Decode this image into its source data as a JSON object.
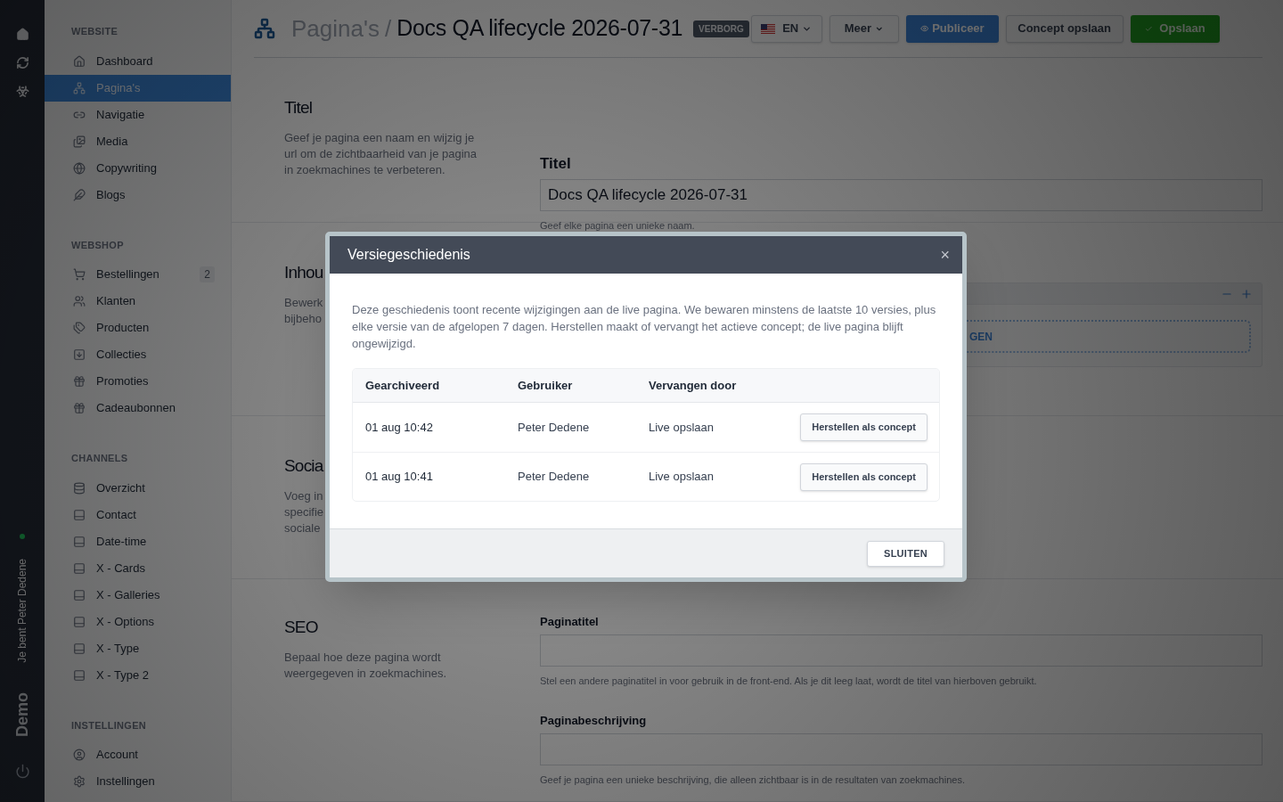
{
  "rail": {
    "online": true,
    "user_label": "Je bent Peter Dedene",
    "brand": "Demo"
  },
  "sidebar": {
    "sections": [
      {
        "title": "WEBSITE",
        "items": [
          {
            "label": "Dashboard",
            "selected": false
          },
          {
            "label": "Pagina's",
            "selected": true
          },
          {
            "label": "Navigatie",
            "selected": false
          },
          {
            "label": "Media",
            "selected": false
          },
          {
            "label": "Copywriting",
            "selected": false
          },
          {
            "label": "Blogs",
            "selected": false
          }
        ]
      },
      {
        "title": "WEBSHOP",
        "items": [
          {
            "label": "Bestellingen",
            "selected": false,
            "badge": "2"
          },
          {
            "label": "Klanten",
            "selected": false
          },
          {
            "label": "Producten",
            "selected": false
          },
          {
            "label": "Collecties",
            "selected": false
          },
          {
            "label": "Promoties",
            "selected": false
          },
          {
            "label": "Cadeaubonnen",
            "selected": false
          }
        ]
      },
      {
        "title": "CHANNELS",
        "items": [
          {
            "label": "Overzicht",
            "selected": false
          },
          {
            "label": "Contact",
            "selected": false
          },
          {
            "label": "Date-time",
            "selected": false
          },
          {
            "label": "X - Cards",
            "selected": false
          },
          {
            "label": "X - Galleries",
            "selected": false
          },
          {
            "label": "X - Options",
            "selected": false
          },
          {
            "label": "X - Type",
            "selected": false
          },
          {
            "label": "X - Type 2",
            "selected": false
          }
        ]
      },
      {
        "title": "INSTELLINGEN",
        "items": [
          {
            "label": "Account",
            "selected": false
          },
          {
            "label": "Instellingen",
            "selected": false
          }
        ]
      }
    ]
  },
  "header": {
    "parent": "Pagina's",
    "separator": "/",
    "title": "Docs QA lifecycle 2026-07-31",
    "badge": "VERBORG",
    "buttons": [
      {
        "label": "EN",
        "kind": "language"
      },
      {
        "label": "Meer",
        "kind": "dropdown"
      },
      {
        "label": "Publiceer",
        "kind": "primary"
      },
      {
        "label": "Concept opslaan",
        "kind": "default"
      },
      {
        "label": "Opslaan",
        "kind": "success"
      }
    ]
  },
  "sections": [
    {
      "kind": "fields",
      "title": "Titel",
      "lines": [
        "Geef je pagina een naam en wijzig je",
        "url om de zichtbaarheid van je pagina",
        "in zoekmachines te verbeteren."
      ],
      "fields": [
        {
          "label": "Titel",
          "value": "Docs QA lifecycle 2026-07-31",
          "help": "Geef elke pagina een unieke naam.",
          "large": true
        }
      ]
    },
    {
      "kind": "content",
      "title": "Inhou",
      "lines": [
        "Bewerk",
        "bijbeho"
      ],
      "add_label": "GEN"
    },
    {
      "kind": "plain",
      "title": "Socia",
      "lines": [
        "Voeg in",
        "specifie",
        "sociale"
      ]
    },
    {
      "kind": "fields",
      "title": "SEO",
      "lines": [
        "Bepaal hoe deze pagina wordt",
        "weergegeven in zoekmachines."
      ],
      "fields": [
        {
          "label": "Paginatitel",
          "help": "Stel een andere paginatitel in voor gebruik in de front-end. Als je dit leeg laat, wordt de titel van hierboven gebruikt.",
          "large": false
        },
        {
          "label": "Paginabeschrijving",
          "help": "Geef je pagina een unieke beschrijving, die alleen zichtbaar is in de resultaten van zoekmachines.",
          "large": false
        }
      ]
    }
  ],
  "modal": {
    "title": "Versiegeschiedenis",
    "close": "×",
    "intro": "Deze geschiedenis toont recente wijzigingen aan de live pagina. We bewaren minstens de laatste 10 versies, plus elke versie van de afgelopen 7 dagen. Herstellen maakt of vervangt het actieve concept; de live pagina blijft ongewijzigd.",
    "columns": [
      "Gearchiveerd",
      "Gebruiker",
      "Vervangen door"
    ],
    "rows": [
      {
        "archived": "01 aug 10:42",
        "user": "Peter Dedene",
        "replaced_by": "Live opslaan",
        "action": "Herstellen als concept"
      },
      {
        "archived": "01 aug 10:41",
        "user": "Peter Dedene",
        "replaced_by": "Live opslaan",
        "action": "Herstellen als concept"
      }
    ],
    "footer_button": "SLUITEN"
  }
}
